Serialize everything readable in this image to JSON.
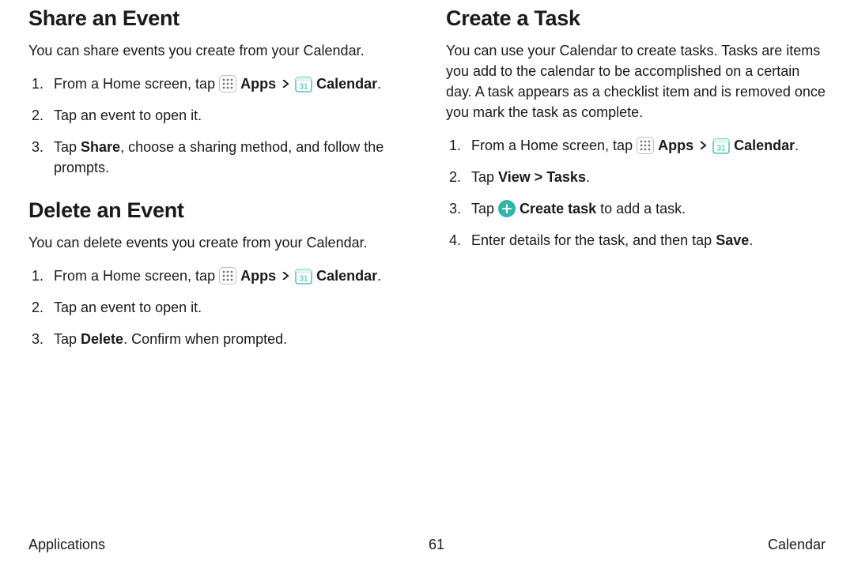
{
  "left": {
    "share": {
      "heading": "Share an Event",
      "lead": "You can share events you create from your Calendar.",
      "step1_pre": "From a Home screen, tap ",
      "apps_label": "Apps",
      "calendar_label": "Calendar",
      "period": ".",
      "step2": "Tap an event to open it.",
      "step3_pre": "Tap ",
      "step3_share": "Share",
      "step3_tail": ", choose a sharing method, and follow the prompts."
    },
    "delete": {
      "heading": "Delete an Event",
      "lead": "You can delete events you create from your Calendar.",
      "step1_pre": "From a Home screen, tap ",
      "apps_label": "Apps",
      "calendar_label": "Calendar",
      "period": ".",
      "step2": "Tap an event to open it.",
      "step3_pre": "Tap ",
      "step3_delete": "Delete",
      "step3_tail": ". Confirm when prompted."
    }
  },
  "right": {
    "task": {
      "heading": "Create a Task",
      "lead": "You can use your Calendar to create tasks. Tasks are items you add to the calendar to be accomplished on a certain day. A task appears as a checklist item and is removed once you mark the task as complete.",
      "step1_pre": "From a Home screen, tap ",
      "apps_label": "Apps",
      "calendar_label": "Calendar",
      "period": ".",
      "step2_pre": "Tap ",
      "step2_view": "View",
      "step2_chev": " > ",
      "step2_tasks": "Tasks",
      "step3_pre": "Tap ",
      "step3_create": "Create task",
      "step3_tail": " to add a task.",
      "step4_pre": "Enter details for the task, and then tap ",
      "step4_save": "Save",
      "step4_tail": "."
    }
  },
  "footer": {
    "left": "Applications",
    "page": "61",
    "right": "Calendar"
  },
  "icons": {
    "calendar_day": "31"
  }
}
